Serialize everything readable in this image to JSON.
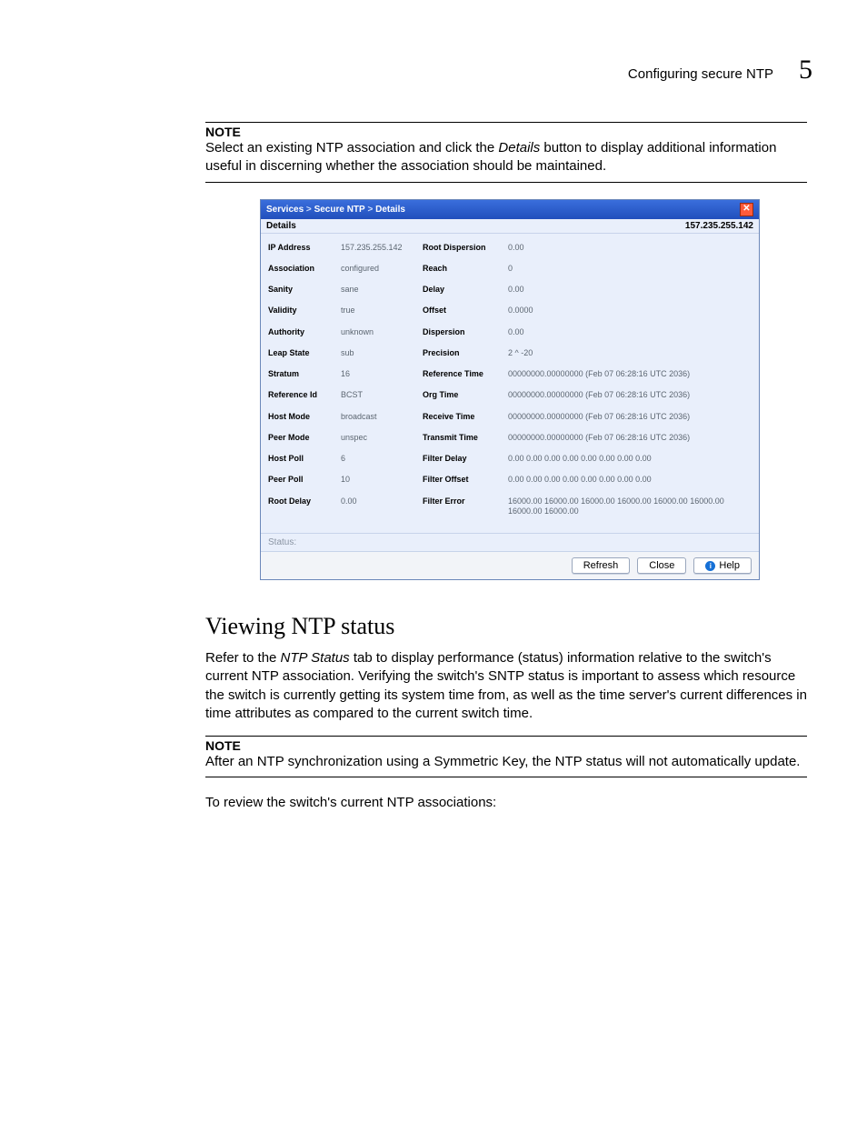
{
  "header": {
    "title": "Configuring secure NTP",
    "chapter": "5"
  },
  "note1": {
    "label": "NOTE",
    "text_before": "Select an existing NTP association and click the ",
    "emph": "Details",
    "text_after": " button to display additional information useful in discerning whether the association should be maintained."
  },
  "dialog": {
    "breadcrumb": {
      "a": "Services",
      "sep1": " > ",
      "b": "Secure NTP",
      "sep2": " > ",
      "c": "Details"
    },
    "subtitle_left": "Details",
    "subtitle_right": "157.235.255.142",
    "status_label": "Status:",
    "buttons": {
      "refresh": "Refresh",
      "close": "Close",
      "help": "Help"
    },
    "rows": [
      {
        "l1": "IP Address",
        "v1": "157.235.255.142",
        "l2": "Root Dispersion",
        "v2": "0.00"
      },
      {
        "l1": "Association",
        "v1": "configured",
        "l2": "Reach",
        "v2": "0"
      },
      {
        "l1": "Sanity",
        "v1": "sane",
        "l2": "Delay",
        "v2": "0.00"
      },
      {
        "l1": "Validity",
        "v1": "true",
        "l2": "Offset",
        "v2": "0.0000"
      },
      {
        "l1": "Authority",
        "v1": "unknown",
        "l2": "Dispersion",
        "v2": "0.00"
      },
      {
        "l1": "Leap State",
        "v1": "sub",
        "l2": "Precision",
        "v2": "2 ^ -20"
      },
      {
        "l1": "Stratum",
        "v1": "16",
        "l2": "Reference Time",
        "v2": "00000000.00000000 (Feb 07 06:28:16 UTC 2036)"
      },
      {
        "l1": "Reference Id",
        "v1": "BCST",
        "l2": "Org Time",
        "v2": "00000000.00000000 (Feb 07 06:28:16 UTC 2036)"
      },
      {
        "l1": "Host Mode",
        "v1": "broadcast",
        "l2": "Receive Time",
        "v2": "00000000.00000000 (Feb 07 06:28:16 UTC 2036)"
      },
      {
        "l1": "Peer Mode",
        "v1": "unspec",
        "l2": "Transmit Time",
        "v2": "00000000.00000000 (Feb 07 06:28:16 UTC 2036)"
      },
      {
        "l1": "Host Poll",
        "v1": "6",
        "l2": "Filter Delay",
        "v2": "0.00 0.00 0.00 0.00 0.00 0.00 0.00 0.00"
      },
      {
        "l1": "Peer Poll",
        "v1": "10",
        "l2": "Filter Offset",
        "v2": "0.00 0.00 0.00 0.00 0.00 0.00 0.00 0.00"
      },
      {
        "l1": "Root Delay",
        "v1": "0.00",
        "l2": "Filter Error",
        "v2": "16000.00 16000.00 16000.00 16000.00 16000.00 16000.00 16000.00 16000.00"
      }
    ]
  },
  "section": {
    "heading": "Viewing NTP status",
    "para_before": "Refer to the ",
    "para_em": "NTP Status",
    "para_after": " tab to display performance (status) information relative to the switch's current NTP association. Verifying the switch's SNTP status is important to assess which resource the switch is currently getting its system time from, as well as the time server's current differences in time attributes as compared to the current switch time."
  },
  "note2": {
    "label": "NOTE",
    "text": "After an NTP synchronization using a Symmetric Key, the NTP status will not automatically update."
  },
  "closing": "To review the switch's current NTP associations:"
}
